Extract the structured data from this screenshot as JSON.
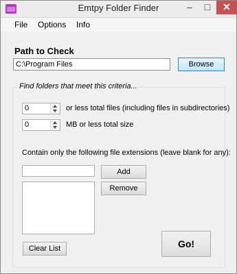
{
  "window": {
    "title": "Emtpy Folder Finder",
    "controls": {
      "minimize": "–",
      "maximize": "□",
      "close": "✕"
    }
  },
  "menu": {
    "items": [
      "File",
      "Options",
      "Info"
    ]
  },
  "path": {
    "label": "Path to Check",
    "value": "C:\\Program Files",
    "browse_label": "Browse"
  },
  "criteria": {
    "legend": "Find folders that meet this criteria...",
    "files_value": "0",
    "files_label": "or less total files (including files in subdirectories)",
    "size_value": "0",
    "size_label": "MB or less total size",
    "ext_label": "Contain only the following file extensions (leave blank for any):",
    "ext_value": "",
    "add_label": "Add",
    "remove_label": "Remove",
    "clear_label": "Clear List"
  },
  "go_label": "Go!"
}
